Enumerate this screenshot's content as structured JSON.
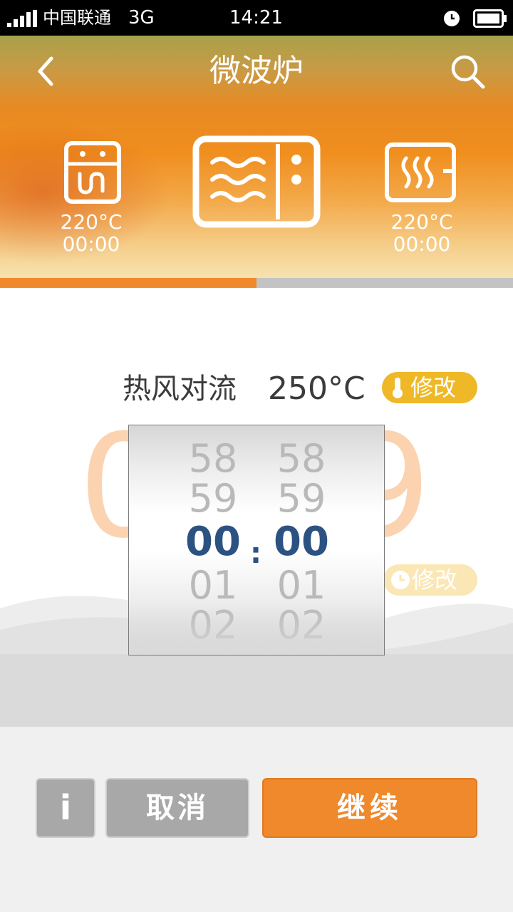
{
  "status_bar": {
    "carrier": "中国联通",
    "network": "3G",
    "time": "14:21"
  },
  "header": {
    "title": "微波炉",
    "back_icon": "chevron-left-icon",
    "search_icon": "search-icon"
  },
  "modes": [
    {
      "icon": "bottom-heat-icon",
      "temp": "220°C",
      "time": "00:00"
    },
    {
      "icon": "microwave-icon",
      "selected": true
    },
    {
      "icon": "steam-heat-icon",
      "temp": "220°C",
      "time": "00:00"
    }
  ],
  "progress": {
    "fraction": 0.5
  },
  "main": {
    "mode_name": "热风对流",
    "mode_temp": "250°C",
    "edit_temp_label": "修改",
    "edit_time_label": "修改",
    "bg_digit_left": "0",
    "bg_digit_right": "9"
  },
  "picker": {
    "hours": [
      "58",
      "59",
      "00",
      "01",
      "02"
    ],
    "minutes": [
      "58",
      "59",
      "00",
      "01",
      "02"
    ],
    "separator": ":"
  },
  "buttons": {
    "info": "i",
    "cancel": "取消",
    "continue": "继续"
  },
  "colors": {
    "accent": "#f0892b",
    "pill_temp": "#efb827",
    "picker_selected": "#2c5282"
  }
}
